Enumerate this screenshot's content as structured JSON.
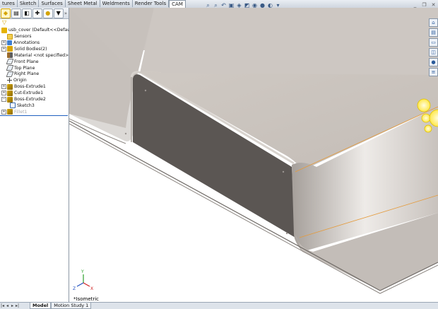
{
  "command_tabs": [
    "tures",
    "Sketch",
    "Surfaces",
    "Sheet Metal",
    "Weldments",
    "Render Tools",
    "CAM"
  ],
  "active_tab": "CAM",
  "hud_icons": [
    "zoom-fit-icon",
    "zoom-area-icon",
    "previous-view-icon",
    "section-view-icon",
    "view-orientation-icon",
    "display-style-icon",
    "hide-show-icon",
    "edit-appearance-icon",
    "apply-scene-icon",
    "view-settings-icon"
  ],
  "hud_glyphs": [
    "⌕",
    "⌕",
    "↶",
    "▣",
    "◈",
    "◩",
    "◉",
    "●",
    "◐",
    "▾"
  ],
  "panel_tabs": [
    "feature-manager-icon",
    "property-manager-icon",
    "configuration-manager-icon",
    "dimxpert-icon",
    "display-manager-icon",
    "cam-manager-icon"
  ],
  "tree": {
    "root": "usb_cover  (Default<<Default>_",
    "items": [
      {
        "label": "Sensors",
        "icon": "folder"
      },
      {
        "label": "Annotations",
        "icon": "annot",
        "expand": "+"
      },
      {
        "label": "Solid Bodies(2)",
        "icon": "solid",
        "expand": "+"
      },
      {
        "label": "Material <not specified>",
        "icon": "mat"
      },
      {
        "label": "Front Plane",
        "icon": "plane"
      },
      {
        "label": "Top Plane",
        "icon": "plane"
      },
      {
        "label": "Right Plane",
        "icon": "plane"
      },
      {
        "label": "Origin",
        "icon": "origin"
      },
      {
        "label": "Boss-Extrude1",
        "icon": "feat",
        "expand": "+"
      },
      {
        "label": "Cut-Extrude1",
        "icon": "feat",
        "expand": "+"
      },
      {
        "label": "Boss-Extrude2",
        "icon": "feat",
        "expand": "−"
      },
      {
        "label": "Sketch3",
        "icon": "sketch",
        "indent": true
      },
      {
        "label": "Fillet1",
        "icon": "feat",
        "expand": "+",
        "suppressed": true
      }
    ]
  },
  "bottom_tabs": [
    "Model",
    "Motion Study 1"
  ],
  "active_bottom_tab": "Model",
  "view_label": "*Isometric",
  "triad": {
    "x": "X",
    "y": "Y",
    "z": "Z"
  },
  "window_controls": [
    "minimize",
    "restore",
    "close"
  ],
  "right_strip": [
    "resources-icon",
    "design-library-icon",
    "file-explorer-icon",
    "view-palette-icon",
    "appearances-icon",
    "custom-properties-icon"
  ],
  "colors": {
    "part_face": "#c8c2bd",
    "dark_wall": "#5a5552",
    "edge_highlight": "#e59a3a",
    "selection": "#ffe84a"
  }
}
